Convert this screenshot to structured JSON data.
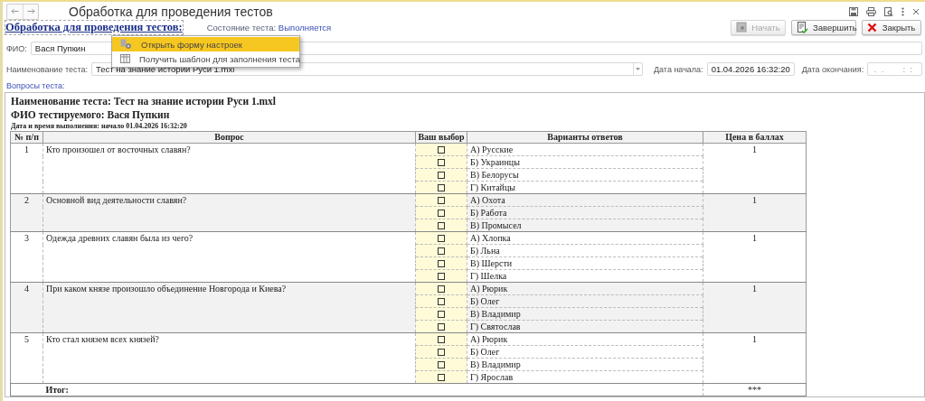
{
  "window": {
    "title": "Обработка для проведения тестов"
  },
  "header": {
    "link": "Обработка для проведения тестов:",
    "state_label": "Состояние теста:",
    "state_value": "Выполняется"
  },
  "buttons": [
    {
      "label": "Начать",
      "kind": "start",
      "disabled": true
    },
    {
      "label": "Завершить",
      "kind": "finish",
      "disabled": false
    },
    {
      "label": "Закрыть",
      "kind": "close",
      "disabled": false
    }
  ],
  "menu": {
    "items": [
      {
        "label": "Открыть форму настроек",
        "kind": "settings",
        "selected": true
      },
      {
        "label": "Получить шаблон для заполнения теста",
        "kind": "template",
        "selected": false
      }
    ]
  },
  "form": {
    "fio": {
      "label": "ФИО:",
      "value": "Вася Пупкин"
    },
    "test_name": {
      "label": "Наименование теста:",
      "value": "Тест на знание истории Руси 1.mxl"
    },
    "start_date": {
      "label": "Дата начала:",
      "value": "01.04.2026 16:32:20"
    },
    "end_date": {
      "label": "Дата окончания:",
      "placeholder": " .  .        :  :"
    }
  },
  "questions_label": "Вопросы теста:",
  "report": {
    "title": "Наименование теста: Тест на знание истории Руси 1.mxl",
    "person": "ФИО тестируемого: Вася Пупкин",
    "date": "Дата и время выполнения: начало 01.04.2026 16:32:20",
    "columns": [
      "№ п/п",
      "Вопрос",
      "Ваш выбор",
      "Варианты ответов",
      "Цена в баллах"
    ],
    "rows": [
      {
        "number": "1",
        "question": "Кто произошел от восточных славян?",
        "points": "1",
        "answers": [
          {
            "text": "А) Русские",
            "checked": false
          },
          {
            "text": "Б) Украинцы",
            "checked": false
          },
          {
            "text": "В) Белорусы",
            "checked": false
          },
          {
            "text": "Г) Китайцы",
            "checked": false
          }
        ]
      },
      {
        "number": "2",
        "question": "Основной вид деятельности славян?",
        "points": "1",
        "answers": [
          {
            "text": "А) Охота",
            "checked": false
          },
          {
            "text": "Б) Работа",
            "checked": false
          },
          {
            "text": "В) Промысел",
            "checked": false
          }
        ]
      },
      {
        "number": "3",
        "question": "Одежда древних славян была из чего?",
        "points": "1",
        "answers": [
          {
            "text": "А) Хлопка",
            "checked": false
          },
          {
            "text": "Б) Льна",
            "checked": false
          },
          {
            "text": "В) Шерсти",
            "checked": false
          },
          {
            "text": "Г) Шелка",
            "checked": false
          }
        ]
      },
      {
        "number": "4",
        "question": "При каком князе произошло объединение Новгорода и Киева?",
        "points": "1",
        "answers": [
          {
            "text": "А) Рюрик",
            "checked": false
          },
          {
            "text": "Б) Олег",
            "checked": false
          },
          {
            "text": "В) Владимир",
            "checked": false
          },
          {
            "text": "Г) Святослав",
            "checked": false
          }
        ]
      },
      {
        "number": "5",
        "question": "Кто стал князем всех князей?",
        "points": "1",
        "answers": [
          {
            "text": "А) Рюрик",
            "checked": false
          },
          {
            "text": "Б) Олег",
            "checked": false
          },
          {
            "text": "В) Владимир",
            "checked": false
          },
          {
            "text": "Г) Ярослав",
            "checked": false
          }
        ]
      }
    ],
    "total": {
      "label": "Итог:",
      "points": "***"
    }
  }
}
